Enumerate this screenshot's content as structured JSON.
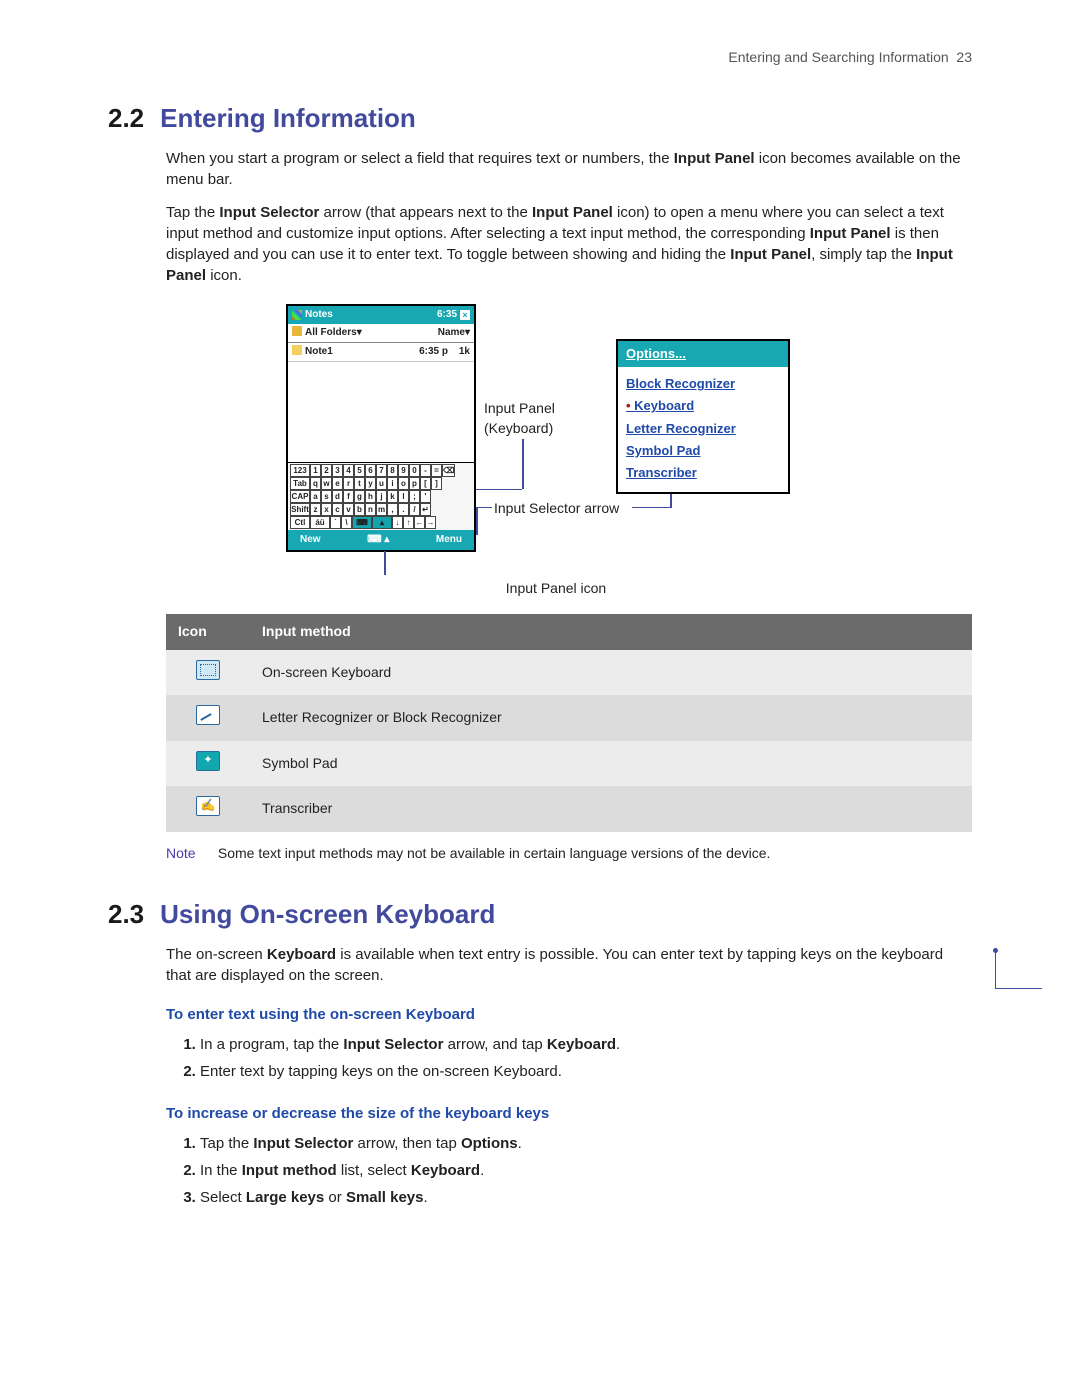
{
  "header": {
    "running": "Entering and Searching Information",
    "page": "23"
  },
  "s22": {
    "num": "2.2",
    "title": "Entering Information",
    "p1": {
      "a": "When you start a program or select a field that requires text or numbers, the ",
      "b": "Input Panel",
      "c": " icon becomes available on the menu bar."
    },
    "p2": {
      "a": "Tap the ",
      "b": "Input Selector",
      "c": " arrow (that appears next to the ",
      "d": "Input Panel",
      "e": " icon) to open a menu where you can select a text input method and customize input options. After selecting a text input method, the corresponding ",
      "f": "Input Panel",
      "g": " is then displayed and you can use it to enter text. To toggle between showing and hiding the ",
      "h": "Input Panel",
      "i": ", simply tap the ",
      "j": "Input Panel",
      "k": " icon."
    }
  },
  "shot": {
    "title": "Notes",
    "time": "6:35",
    "folders_left": "All Folders",
    "folders_right": "Name",
    "row_name": "Note1",
    "row_time": "6:35 p",
    "row_size": "1k",
    "bar_new": "New",
    "bar_menu": "Menu",
    "krow0": [
      "123",
      "1",
      "2",
      "3",
      "4",
      "5",
      "6",
      "7",
      "8",
      "9",
      "0",
      "-",
      "=",
      "⌫"
    ],
    "krow1": [
      "Tab",
      "q",
      "w",
      "e",
      "r",
      "t",
      "y",
      "u",
      "i",
      "o",
      "p",
      "[",
      "]"
    ],
    "krow2": [
      "CAP",
      "a",
      "s",
      "d",
      "f",
      "g",
      "h",
      "j",
      "k",
      "l",
      ";",
      "'"
    ],
    "krow3": [
      "Shift",
      "z",
      "x",
      "c",
      "v",
      "b",
      "n",
      "m",
      ",",
      ".",
      "/",
      "↵"
    ],
    "krow4": [
      "Ctl",
      "áü",
      "`",
      "\\",
      " ",
      " ",
      "↓",
      "↑",
      "←",
      "→"
    ]
  },
  "callouts": {
    "input_panel_kb1": "Input Panel",
    "input_panel_kb2": "(Keyboard)",
    "input_selector_arrow": "Input Selector arrow",
    "input_panel_icon": "Input Panel icon"
  },
  "popup": {
    "options": "Options...",
    "items": [
      "Block Recognizer",
      "Keyboard",
      "Letter Recognizer",
      "Symbol Pad",
      "Transcriber"
    ],
    "selected": 1
  },
  "table": {
    "h1": "Icon",
    "h2": "Input method",
    "rows": [
      {
        "icon": "kb",
        "label": "On-screen Keyboard"
      },
      {
        "icon": "pen",
        "label": "Letter Recognizer or Block Recognizer"
      },
      {
        "icon": "sym",
        "label": "Symbol Pad"
      },
      {
        "icon": "tr",
        "label": "Transcriber"
      }
    ]
  },
  "note": {
    "label": "Note",
    "text": "Some text input methods may not be available in certain language versions of the device."
  },
  "s23": {
    "num": "2.3",
    "title": "Using On-screen Keyboard",
    "p": {
      "a": "The on-screen ",
      "b": "Keyboard",
      "c": " is available when text entry is possible. You can enter text by tapping keys on the keyboard that are displayed on the screen."
    },
    "sub1": "To enter text using the on-screen Keyboard",
    "steps1": [
      {
        "a": "In a program, tap the ",
        "b": "Input Selector",
        "c": " arrow, and tap ",
        "d": "Keyboard",
        "e": "."
      },
      {
        "a": "Enter text by tapping keys on the on-screen Keyboard."
      }
    ],
    "sub2": "To increase or decrease the size of the keyboard keys",
    "steps2": [
      {
        "a": "Tap the ",
        "b": "Input Selector",
        "c": " arrow, then tap ",
        "d": "Options",
        "e": "."
      },
      {
        "a": "In the ",
        "b": "Input method",
        "c": " list, select ",
        "d": "Keyboard",
        "e": "."
      },
      {
        "a": "Select ",
        "b": "Large keys",
        "c": " or ",
        "d": "Small keys",
        "e": "."
      }
    ]
  }
}
